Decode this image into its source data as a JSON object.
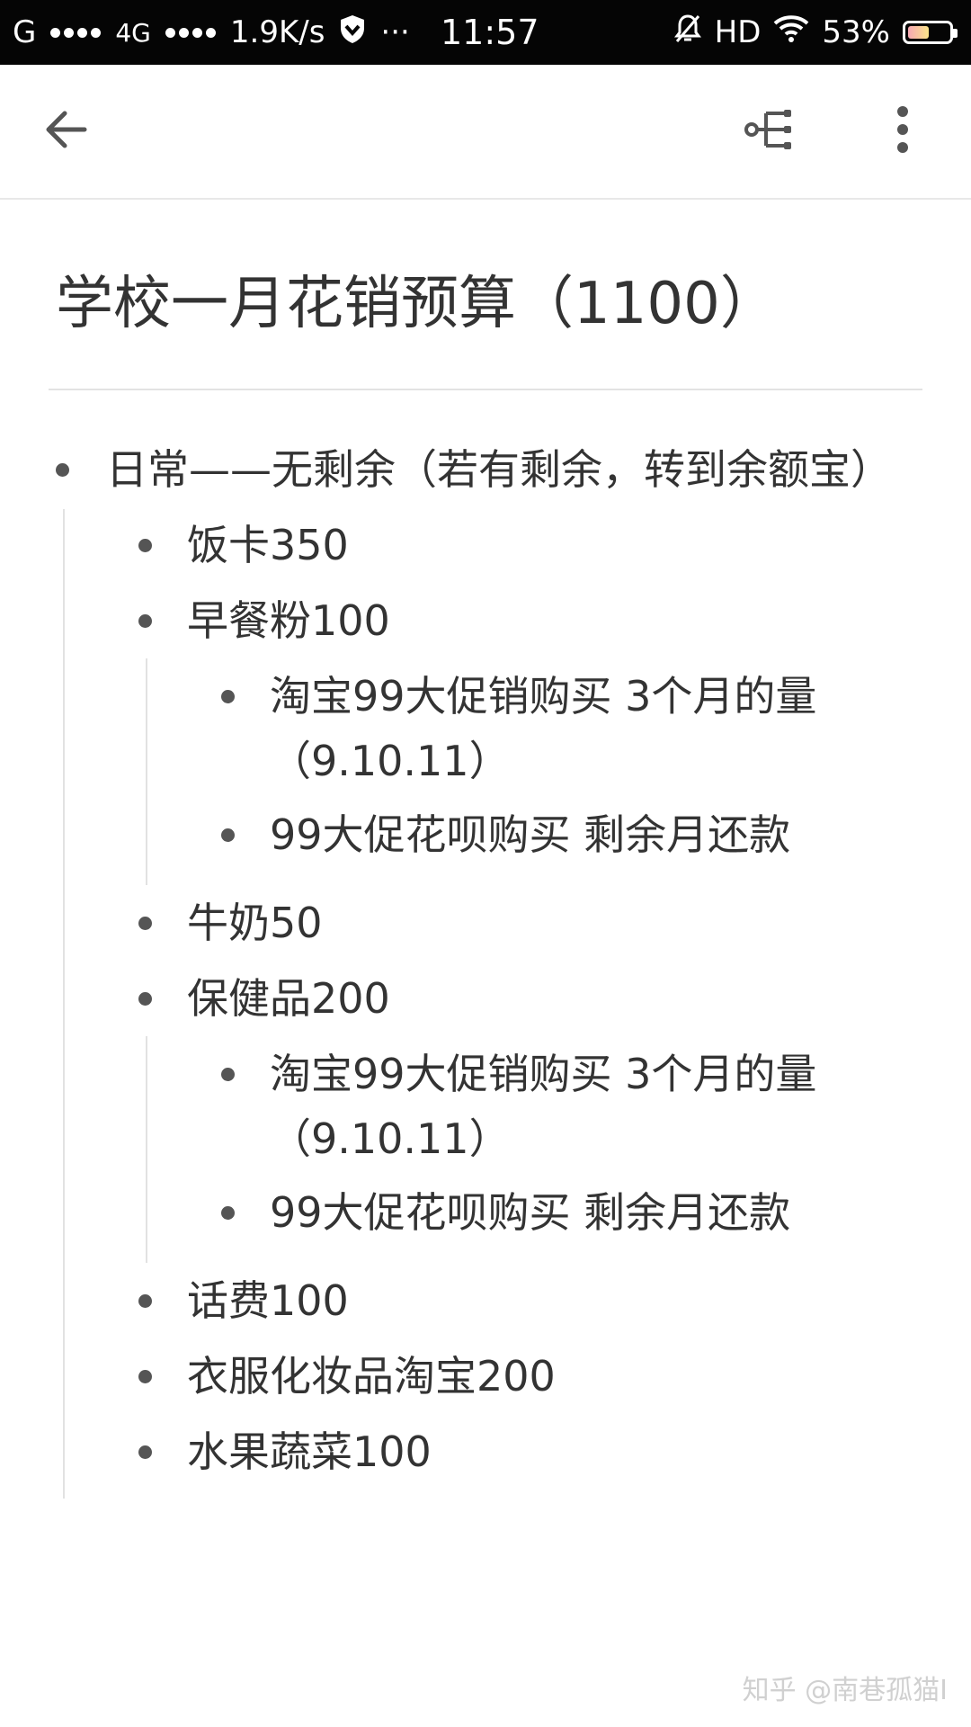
{
  "status_bar": {
    "carrier1": "G",
    "carrier2": "4G",
    "speed": "1.9K/s",
    "more": "···",
    "time": "11:57",
    "hd": "HD",
    "battery": "53%",
    "battery_level": 0.53
  },
  "toolbar": {
    "back_icon": "arrow-left-icon",
    "mindmap_icon": "mindmap-icon",
    "more_icon": "more-vertical-icon"
  },
  "document": {
    "title": "学校一月花销预算（1100）",
    "items": [
      {
        "label": "日常——无剩余（若有剩余，转到余额宝）",
        "children": [
          {
            "label": "饭卡350"
          },
          {
            "label": "早餐粉100",
            "children": [
              {
                "line1": "淘宝99大促销购买   3个月的量",
                "line2": "（9.10.11）"
              },
              {
                "line1": "99大促花呗购买   剩余月还款"
              }
            ]
          },
          {
            "label": "牛奶50"
          },
          {
            "label": "保健品200",
            "children": [
              {
                "line1": "淘宝99大促销购买   3个月的量",
                "line2": "（9.10.11）"
              },
              {
                "line1": "99大促花呗购买   剩余月还款"
              }
            ]
          },
          {
            "label": "话费100"
          },
          {
            "label": "衣服化妆品淘宝200"
          },
          {
            "label": "水果蔬菜100"
          }
        ]
      }
    ]
  },
  "watermark": "知乎 @南巷孤猫I"
}
